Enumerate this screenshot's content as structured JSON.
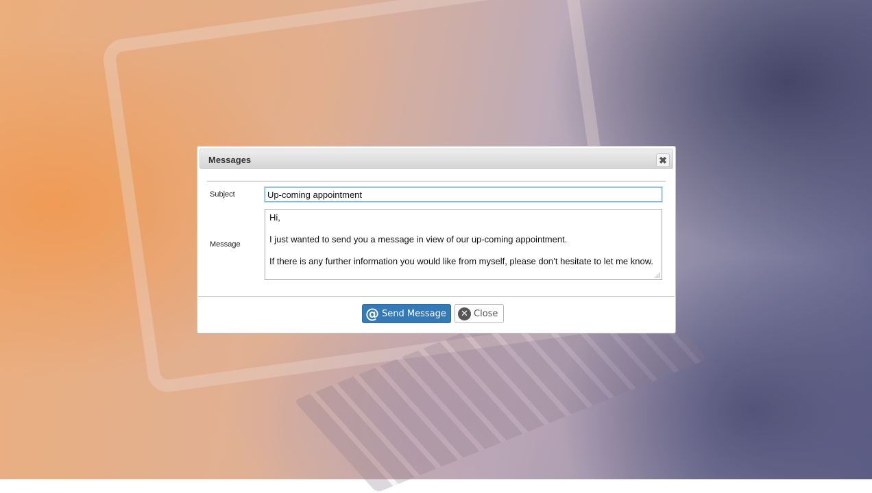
{
  "dialog": {
    "title": "Messages",
    "close_glyph": "✖",
    "subject_label": "Subject",
    "subject_value": "Up-coming appointment",
    "message_label": "Message",
    "message_lines": [
      "Hi,",
      "I just wanted to send you a message in view of our up-coming appointment.",
      "If there is any further information you would like from myself, please don’t hesitate to let me know."
    ],
    "send_button": {
      "icon": "at-icon",
      "icon_glyph": "@",
      "label": "Send Message"
    },
    "close_button": {
      "icon": "close-circle-icon",
      "icon_glyph": "✕",
      "label": "Close"
    }
  },
  "colors": {
    "primary_button": "#337ab7",
    "input_focus_border": "#6ea8c8"
  }
}
